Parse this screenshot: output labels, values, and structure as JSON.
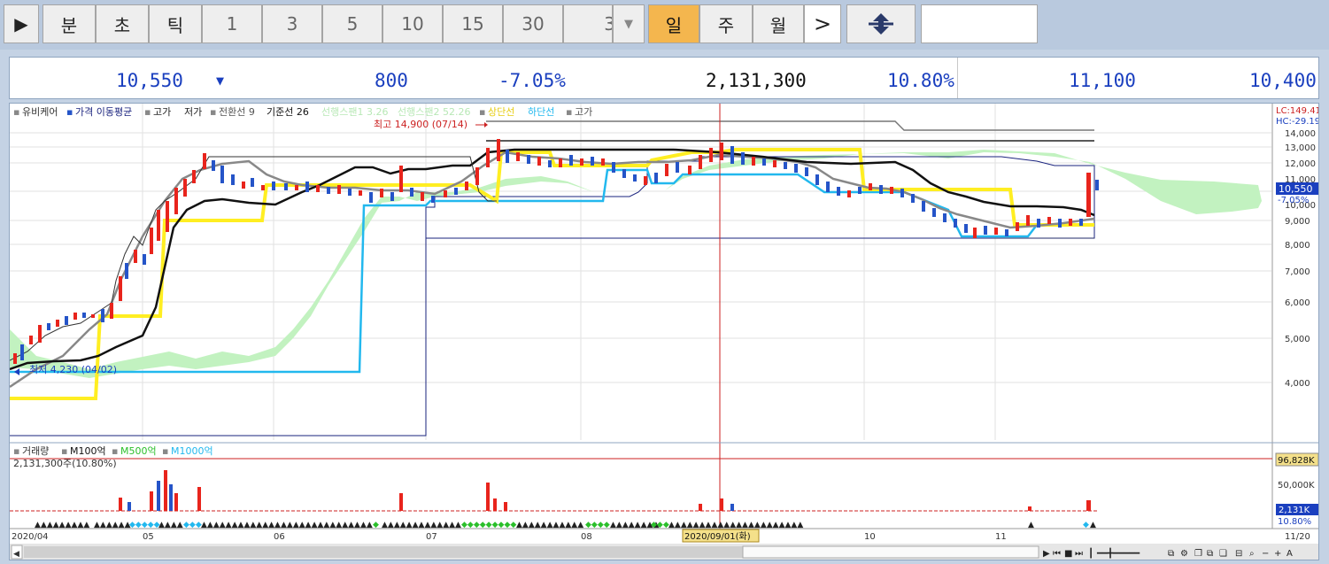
{
  "toolbar": {
    "play_label": "▶",
    "period_buttons": [
      "분",
      "초",
      "틱",
      "1",
      "3",
      "5",
      "10",
      "15",
      "30",
      "3"
    ],
    "cycle_buttons": [
      "일",
      "주",
      "월"
    ],
    "active": "일",
    "next_label": ">"
  },
  "quote": {
    "price": "10,550",
    "direction": "▼",
    "change": "800",
    "change_pct": "-7.05%",
    "volume": "2,131,300",
    "volume_pct": "10.80%",
    "high": "11,100",
    "low": "10,400"
  },
  "price_legend": {
    "name": "유비케어",
    "ma_label": "가격 이동평균",
    "high_label": "고가",
    "low_label": "저가",
    "conv": "전환선 9",
    "base": "기준선 26",
    "span1": "선행스팬1 3.26",
    "span2": "선행스팬2 52.26",
    "upper": "상단선",
    "lower": "하단선",
    "high2": "고가"
  },
  "annotations": {
    "max_label": "최고 14,900 (07/14)",
    "min_label": "최저 4,230 (04/02)",
    "lc": "LC:149.41",
    "hc": "HC:-29.19",
    "price_tag": "10,550",
    "pct_tag": "-7.05%",
    "vol_max_tag": "96,828K",
    "vol_cur_tag": "2,131K",
    "vol_pct_tag": "10.80%",
    "cursor_date": "2020/09/01(화)"
  },
  "volume_legend": {
    "vol": "거래량",
    "m100": "M100억",
    "m500": "M500억",
    "m1000": "M1000억",
    "info": "2,131,300주(10.80%)"
  },
  "colors": {
    "up": "#e8241c",
    "down": "#2554c8",
    "yellow": "#ffee22",
    "cyan": "#22b8ee",
    "cloud": "#c2f2c0",
    "gray": "#8a8a8a",
    "black": "#111111"
  },
  "chart_data": {
    "type": "candlestick",
    "y_ticks": [
      "14,000",
      "13,000",
      "12,000",
      "11,000",
      "10,000",
      "9,000",
      "8,000",
      "7,000",
      "6,000",
      "5,000",
      "4,000"
    ],
    "vol_ticks": [
      "50,000K"
    ],
    "x_labels": [
      "2020/04",
      "05",
      "06",
      "07",
      "08",
      "10",
      "11",
      "11/20"
    ],
    "last_price": 10550,
    "max_price": 14900,
    "min_price": 4230
  }
}
